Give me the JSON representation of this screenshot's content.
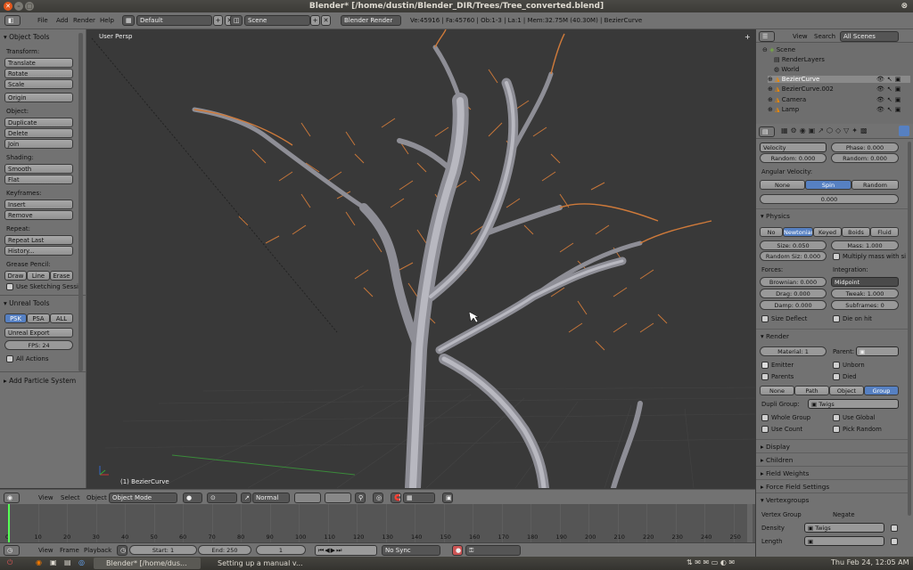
{
  "window": {
    "title": "Blender* [/home/dustin/Blender_DIR/Trees/Tree_converted.blend]"
  },
  "info": {
    "menus": [
      "File",
      "Add",
      "Render",
      "Help"
    ],
    "layout": "Default",
    "scene": "Scene",
    "engine": "Blender Render",
    "stats": "Ve:45916 | Fa:45760 | Ob:1-3 | La:1 | Mem:32.75M (40.30M) | BezierCurve"
  },
  "toolshelf": {
    "title": "Object Tools",
    "transform_label": "Transform:",
    "transform": [
      "Translate",
      "Rotate",
      "Scale"
    ],
    "origin": "Origin",
    "object_label": "Object:",
    "object": [
      "Duplicate",
      "Delete",
      "Join"
    ],
    "shading_label": "Shading:",
    "shading": [
      "Smooth",
      "Flat"
    ],
    "keyframes_label": "Keyframes:",
    "keyframes": [
      "Insert",
      "Remove"
    ],
    "repeat_label": "Repeat:",
    "repeat": [
      "Repeat Last",
      "History..."
    ],
    "grease_label": "Grease Pencil:",
    "grease": [
      "Draw",
      "Line",
      "Erase"
    ],
    "sketching": "Use Sketching Sessio",
    "unreal_title": "Unreal Tools",
    "unreal_tabs": [
      "PSK",
      "PSA",
      "ALL"
    ],
    "unreal_export": "Unreal Export",
    "fps": "FPS: 24",
    "all_actions": "All Actions",
    "add_particle": "Add Particle System"
  },
  "viewport": {
    "view_label": "User Persp",
    "object_label": "(1) BezierCurve"
  },
  "vpheader": {
    "menus": [
      "View",
      "Select",
      "Object"
    ],
    "mode": "Object Mode",
    "orientation": "Normal"
  },
  "timeline": {
    "ticks": [
      "0",
      "10",
      "20",
      "30",
      "40",
      "50",
      "60",
      "70",
      "80",
      "90",
      "100",
      "110",
      "120",
      "130",
      "140",
      "150",
      "160",
      "170",
      "180",
      "190",
      "200",
      "210",
      "220",
      "230",
      "240",
      "250"
    ],
    "current_frame": 1
  },
  "tlheader": {
    "menus": [
      "View",
      "Frame",
      "Playback"
    ],
    "start": "Start: 1",
    "end": "End: 250",
    "frame": "1",
    "sync": "No Sync"
  },
  "outliner": {
    "menus": [
      "View",
      "Search"
    ],
    "filter": "All Scenes",
    "items": [
      "Scene",
      "RenderLayers",
      "World",
      "BezierCurve",
      "BezierCurve.002",
      "Camera",
      "Lamp"
    ]
  },
  "props": {
    "velocity": "Velocity",
    "phase": "Phase: 0.000",
    "random1": "Random: 0.000",
    "random2": "Random: 0.000",
    "angular_label": "Angular Velocity:",
    "angular_opts": [
      "None",
      "Spin",
      "Random"
    ],
    "angular_value": "0.000",
    "physics_head": "Physics",
    "physics_opts": [
      "No",
      "Newtonian",
      "Keyed",
      "Boids",
      "Fluid"
    ],
    "size": "Size: 0.050",
    "mass": "Mass: 1.000",
    "random_size": "Random Siz: 0.000",
    "multiply_mass": "Multiply mass with si",
    "forces_label": "Forces:",
    "integration_label": "Integration:",
    "brownian": "Brownian: 0.000",
    "integration": "Midpoint",
    "drag": "Drag: 0.000",
    "tweak": "Tweak: 1.000",
    "damp": "Damp: 0.000",
    "subframes": "Subframes: 0",
    "size_deflect": "Size Deflect",
    "die_on_hit": "Die on hit",
    "render_head": "Render",
    "material": "Material: 1",
    "parent_label": "Parent:",
    "emitter": "Emitter",
    "unborn": "Unborn",
    "parents": "Parents",
    "died": "Died",
    "render_opts": [
      "None",
      "Path",
      "Object",
      "Group"
    ],
    "dupli_label": "Dupli Group:",
    "dupli_value": "Twigs",
    "whole_group": "Whole Group",
    "use_global": "Use Global",
    "use_count": "Use Count",
    "pick_random": "Pick Random",
    "collapsed": [
      "Display",
      "Children",
      "Field Weights",
      "Force Field Settings"
    ],
    "vertexgroups_head": "Vertexgroups",
    "vg_col1": "Vertex Group",
    "vg_col2": "Negate",
    "density": "Density",
    "density_value": "Twigs",
    "length": "Length"
  },
  "taskbar": {
    "task1": "Blender* [/home/dus...",
    "task2": "Setting up a manual v...",
    "clock": "Thu Feb 24, 12:05 AM"
  }
}
